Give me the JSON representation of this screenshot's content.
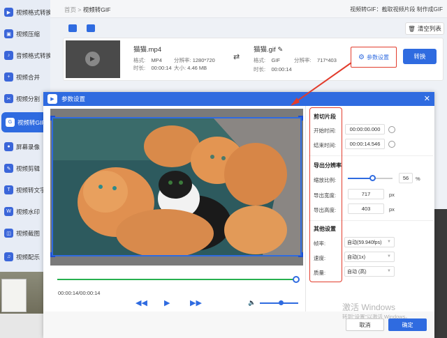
{
  "sidebar": {
    "items": [
      {
        "label": "视频格式转换",
        "active": false
      },
      {
        "label": "视频压缩",
        "active": false
      },
      {
        "label": "音频格式转换",
        "active": false
      },
      {
        "label": "视频合并",
        "active": false
      },
      {
        "label": "视频分割",
        "active": false
      },
      {
        "label": "视频转GIF",
        "active": true
      },
      {
        "label": "屏幕录像",
        "active": false
      },
      {
        "label": "视频剪辑",
        "active": false
      },
      {
        "label": "视频转文字",
        "active": false
      },
      {
        "label": "视频水印",
        "active": false
      },
      {
        "label": "视频截图",
        "active": false
      },
      {
        "label": "视频配乐",
        "active": false
      }
    ]
  },
  "header": {
    "breadcrumb_home": "首页",
    "breadcrumb_sep": ">",
    "breadcrumb_current": "视频转GIF",
    "right_text": "视频转GIF：截取视频片段 制作成GIF"
  },
  "toolbar": {
    "clear_label": "清空列表"
  },
  "file": {
    "src_name": "猫猫.mp4",
    "src_format_label": "格式:",
    "src_format": "MP4",
    "src_res_label": "分辨率:",
    "src_res": "1280*720",
    "src_duration_label": "时长:",
    "src_duration": "00:00:14",
    "src_size_label": "大小:",
    "src_size": "4.46 MB",
    "dst_name": "猫猫.gif",
    "dst_format_label": "格式:",
    "dst_format": "GIF",
    "dst_res_label": "分辨率:",
    "dst_res": "717*403",
    "dst_duration_label": "时长:",
    "dst_duration": "00:00:14",
    "param_label": "参数设置",
    "convert_label": "转换"
  },
  "dialog": {
    "title": "参数设置",
    "time_display": "00:00:14/00:00:14",
    "progress": 1.0,
    "volume": 0.55,
    "clip": {
      "section": "剪切片段",
      "start_label": "开始时间:",
      "start": "00:00:00.000",
      "end_label": "结束时间:",
      "end": "00:00:14.546"
    },
    "resolution": {
      "section": "导出分辨率",
      "scale_label": "缩放比例:",
      "scale": "56",
      "scale_unit": "%",
      "width_label": "导出宽度:",
      "width": "717",
      "height_label": "导出高度:",
      "height": "403",
      "px": "px"
    },
    "other": {
      "section": "其他设置",
      "fps_label": "帧率:",
      "fps": "自动(59.940fps)",
      "speed_label": "速度:",
      "speed": "自动(1x)",
      "quality_label": "质量:",
      "quality": "自动 (高)"
    },
    "cancel_label": "取消",
    "ok_label": "确定"
  },
  "watermark": {
    "line1": "激活 Windows",
    "line2": "转到\"设置\"以激活 Windows。"
  },
  "colors": {
    "accent": "#2f6be0",
    "highlight": "#e23c2c",
    "progress": "#27b04f"
  }
}
